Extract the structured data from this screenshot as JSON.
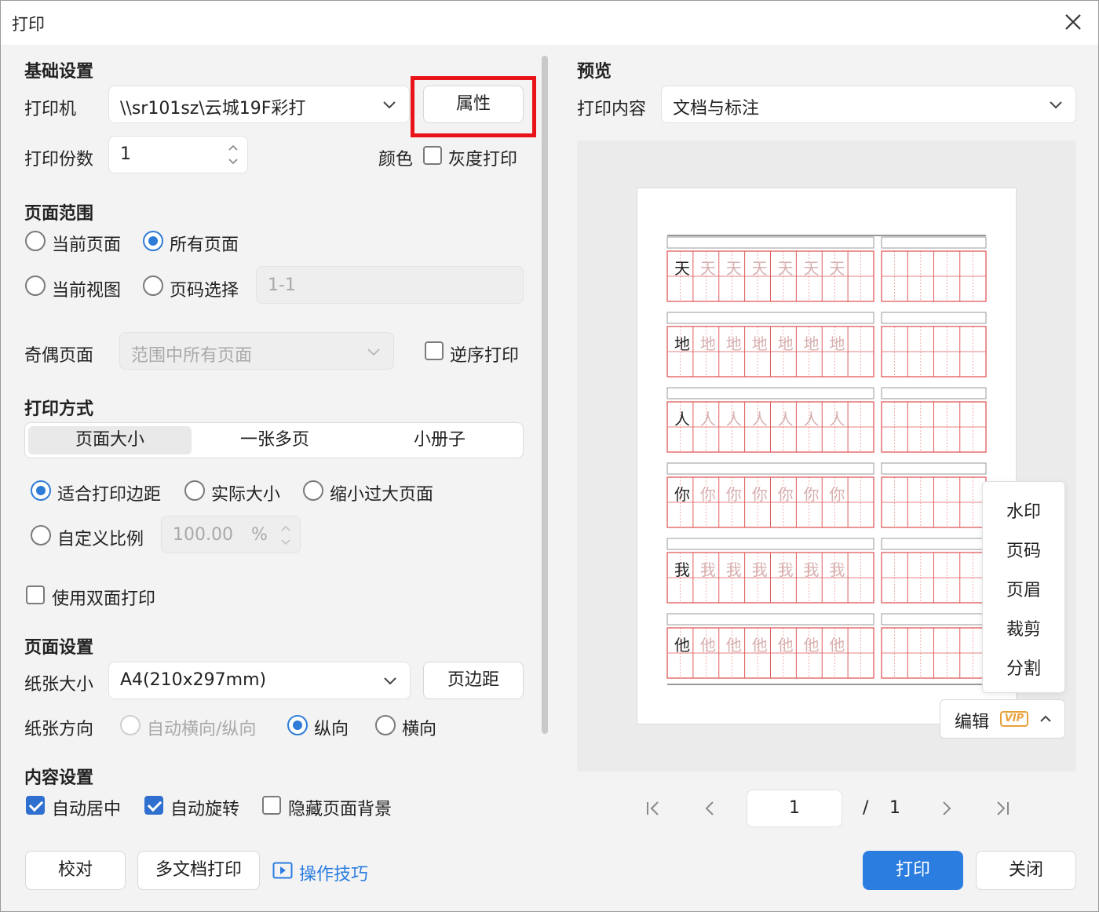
{
  "window": {
    "title": "打印"
  },
  "basic": {
    "section_title": "基础设置",
    "printer_label": "打印机",
    "printer_value": "\\\\sr101sz\\云城19F彩打",
    "properties_button": "属性",
    "copies_label": "打印份数",
    "copies_value": "1",
    "color_label": "颜色",
    "grayscale_label": "灰度打印",
    "grayscale_checked": false
  },
  "range": {
    "section_title": "页面范围",
    "current_page": "当前页面",
    "all_pages": "所有页面",
    "current_view": "当前视图",
    "page_select": "页码选择",
    "page_select_value": "1-1",
    "selected": "所有页面",
    "odd_even_label": "奇偶页面",
    "odd_even_value": "范围中所有页面",
    "reverse_label": "逆序打印",
    "reverse_checked": false
  },
  "method": {
    "section_title": "打印方式",
    "tabs": [
      "页面大小",
      "一张多页",
      "小册子"
    ],
    "active_tab": "页面大小",
    "fit_margin": "适合打印边距",
    "actual_size": "实际大小",
    "shrink_large": "缩小过大页面",
    "selected": "适合打印边距",
    "custom_scale": "自定义比例",
    "scale_value": "100.00",
    "scale_unit": "%",
    "duplex_label": "使用双面打印",
    "duplex_checked": false
  },
  "page_setup": {
    "section_title": "页面设置",
    "paper_size_label": "纸张大小",
    "paper_size_value": "A4(210x297mm)",
    "margins_button": "页边距",
    "orientation_label": "纸张方向",
    "auto_orientation": "自动横向/纵向",
    "portrait": "纵向",
    "landscape": "横向",
    "selected": "纵向"
  },
  "content": {
    "section_title": "内容设置",
    "auto_center": "自动居中",
    "auto_center_checked": true,
    "auto_rotate": "自动旋转",
    "auto_rotate_checked": true,
    "hide_background": "隐藏页面背景",
    "hide_background_checked": false
  },
  "footer": {
    "proof_button": "校对",
    "multi_doc_button": "多文档打印",
    "tips_link": "操作技巧",
    "print_button": "打印",
    "close_button": "关闭"
  },
  "preview": {
    "section_title": "预览",
    "content_label": "打印内容",
    "content_value": "文档与标注",
    "worksheet_chars": [
      "天",
      "地",
      "人",
      "你",
      "我",
      "他"
    ],
    "menu_items": [
      "水印",
      "页码",
      "页眉",
      "裁剪",
      "分割"
    ],
    "edit_button": "编辑",
    "vip_badge": "VIP",
    "current_page": "1",
    "page_separator": "/",
    "total_pages": "1"
  },
  "colors": {
    "accent": "#2b7de0",
    "highlight_box": "#e8141a",
    "grid_red": "#e05a5a",
    "vip": "#e8a23d"
  }
}
